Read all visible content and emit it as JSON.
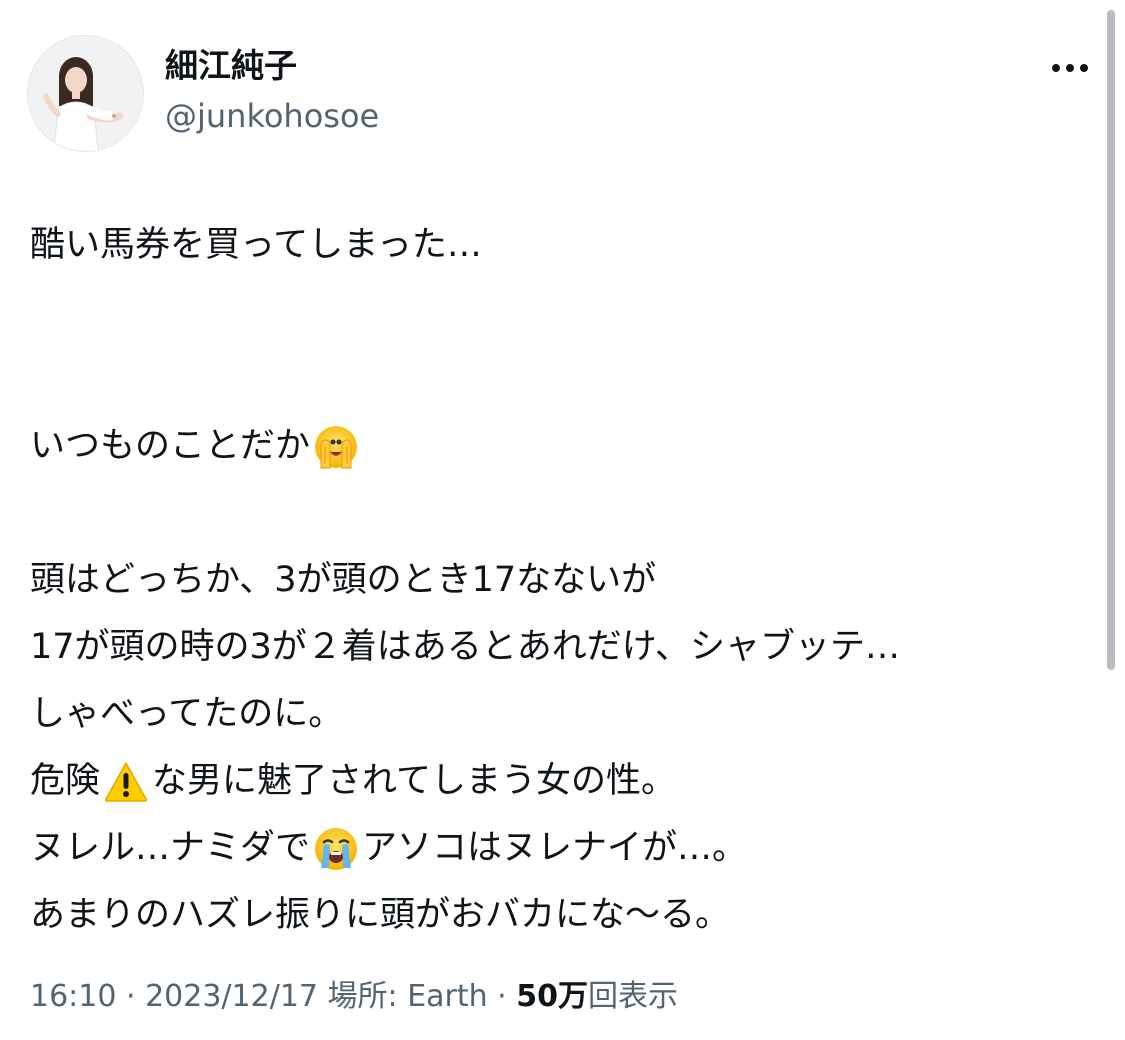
{
  "author": {
    "display_name": "細江純子",
    "handle": "@junkohosoe"
  },
  "tweet": {
    "line1": "酷い馬券を買ってしまった…",
    "line2": "いつものことだか",
    "line2_emoji": "face-with-open-eyes-and-hand-over-mouth-emoji",
    "line3": "頭はどっちか、3が頭のとき17なないが",
    "line4": "17が頭の時の3が２着はあるとあれだけ、シャブッテ…",
    "line5": "しゃべってたのに。",
    "line6_a": "危険",
    "line6_emoji": "warning-emoji",
    "line6_b": "な男に魅了されてしまう女の性。",
    "line7_a": "ヌレル…ナミダで",
    "line7_emoji": "loudly-crying-face-emoji",
    "line7_b": "アソコはヌレナイが…。",
    "line8": "あまりのハズレ振りに頭がおバカにな〜る。"
  },
  "meta": {
    "time": "16:10",
    "sep1": " · ",
    "date": "2023/12/17",
    "location": "場所: Earth",
    "sep2": " · ",
    "views_count": "50万",
    "views_label": "回表示"
  },
  "icons": {
    "more": "more-options-icon"
  }
}
